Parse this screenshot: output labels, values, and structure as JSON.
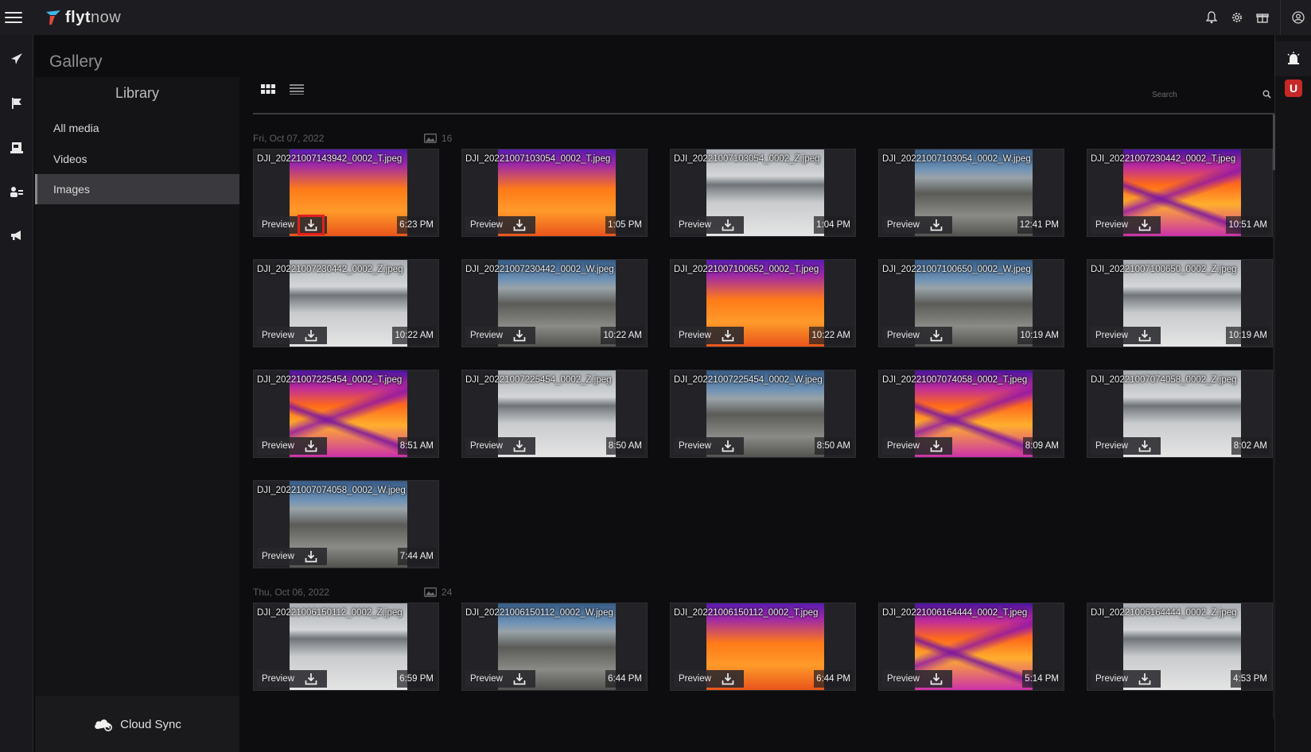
{
  "app": {
    "brand": "flyt",
    "brand_suffix": "now"
  },
  "page": {
    "title": "Gallery"
  },
  "sidebar": {
    "heading": "Library",
    "items": [
      {
        "label": "All media"
      },
      {
        "label": "Videos"
      },
      {
        "label": "Images"
      }
    ],
    "cloud_sync": "Cloud Sync"
  },
  "toolbar": {
    "search_placeholder": "Search"
  },
  "groups": [
    {
      "date": "Fri, Oct 07, 2022",
      "count": "16",
      "items": [
        {
          "name": "DJI_20221007143942_0002_T.jpeg",
          "time": "6:23 PM",
          "kind": "thermal"
        },
        {
          "name": "DJI_20221007103054_0002_T.jpeg",
          "time": "1:05 PM",
          "kind": "thermal"
        },
        {
          "name": "DJI_20221007103054_0002_Z.jpeg",
          "time": "1:04 PM",
          "kind": "zoom"
        },
        {
          "name": "DJI_20221007103054_0002_W.jpeg",
          "time": "12:41 PM",
          "kind": "wide"
        },
        {
          "name": "DJI_20221007230442_0002_T.jpeg",
          "time": "10:51 AM",
          "kind": "thermal2"
        },
        {
          "name": "DJI_20221007230442_0002_Z.jpeg",
          "time": "10:22 AM",
          "kind": "zoom"
        },
        {
          "name": "DJI_20221007230442_0002_W.jpeg",
          "time": "10:22 AM",
          "kind": "wide"
        },
        {
          "name": "DJI_20221007100652_0002_T.jpeg",
          "time": "10:22 AM",
          "kind": "thermal"
        },
        {
          "name": "DJI_20221007100650_0002_W.jpeg",
          "time": "10:19 AM",
          "kind": "wide"
        },
        {
          "name": "DJI_20221007100650_0002_Z.jpeg",
          "time": "10:19 AM",
          "kind": "zoom"
        },
        {
          "name": "DJI_20221007225454_0002_T.jpeg",
          "time": "8:51 AM",
          "kind": "thermal2"
        },
        {
          "name": "DJI_20221007225454_0002_Z.jpeg",
          "time": "8:50 AM",
          "kind": "zoom"
        },
        {
          "name": "DJI_20221007225454_0002_W.jpeg",
          "time": "8:50 AM",
          "kind": "wide"
        },
        {
          "name": "DJI_20221007074058_0002_T.jpeg",
          "time": "8:09 AM",
          "kind": "thermal2"
        },
        {
          "name": "DJI_20221007074058_0002_Z.jpeg",
          "time": "8:02 AM",
          "kind": "zoom"
        },
        {
          "name": "DJI_20221007074058_0002_W.jpeg",
          "time": "7:44 AM",
          "kind": "wide"
        }
      ]
    },
    {
      "date": "Thu, Oct 06, 2022",
      "count": "24",
      "items": [
        {
          "name": "DJI_20221006150112_0002_Z.jpeg",
          "time": "6:59 PM",
          "kind": "zoom"
        },
        {
          "name": "DJI_20221006150112_0002_W.jpeg",
          "time": "6:44 PM",
          "kind": "wide"
        },
        {
          "name": "DJI_20221006150112_0002_T.jpeg",
          "time": "6:44 PM",
          "kind": "thermal"
        },
        {
          "name": "DJI_20221006164444_0002_T.jpeg",
          "time": "5:14 PM",
          "kind": "thermal2"
        },
        {
          "name": "DJI_20221006164444_0002_Z.jpeg",
          "time": "4:53 PM",
          "kind": "zoom"
        }
      ]
    }
  ],
  "card_actions": {
    "preview_label": "Preview"
  },
  "colors": {
    "accent_highlight": "#e0201f",
    "badge": "#c62828"
  }
}
